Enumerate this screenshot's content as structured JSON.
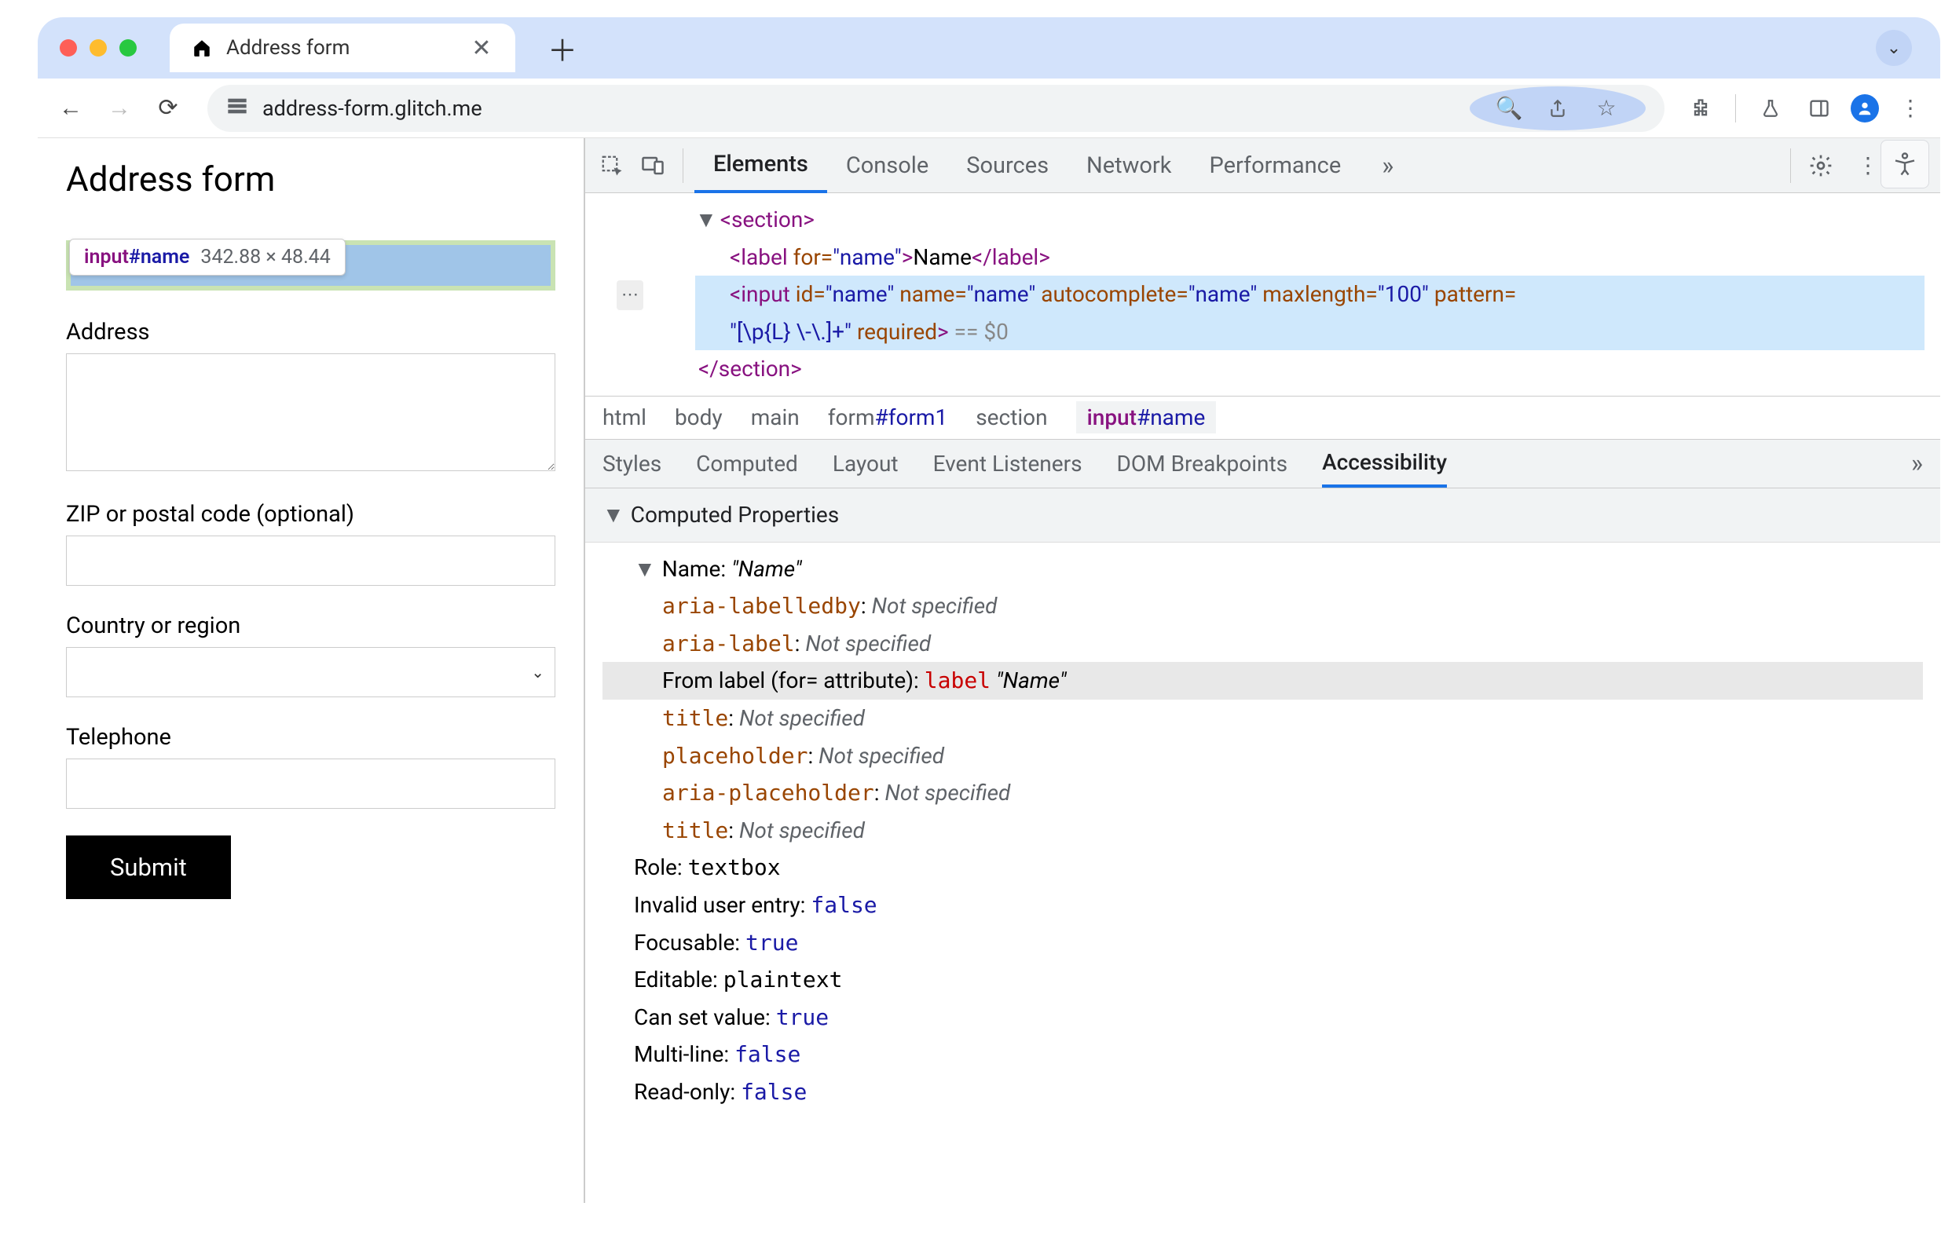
{
  "browser": {
    "tab_title": "Address form",
    "url": "address-form.glitch.me"
  },
  "page": {
    "title": "Address form",
    "tooltip": {
      "tag": "input",
      "id": "#name",
      "dims": "342.88 × 48.44"
    },
    "labels": {
      "address": "Address",
      "zip": "ZIP or postal code (optional)",
      "country": "Country or region",
      "telephone": "Telephone",
      "submit": "Submit"
    }
  },
  "devtools": {
    "tabs": [
      "Elements",
      "Console",
      "Sources",
      "Network",
      "Performance"
    ],
    "active_tab": "Elements",
    "more": "»",
    "dom": {
      "section_open": "<section>",
      "label_open": "<label ",
      "label_for_attr": "for=",
      "label_for_val": "\"name\"",
      "label_close": ">",
      "label_text": "Name",
      "label_end": "</label>",
      "input_open": "<input ",
      "id_attr": "id=",
      "id_val": "\"name\"",
      "name_attr": "name=",
      "name_val": "\"name\"",
      "ac_attr": "autocomplete=",
      "ac_val": "\"name\"",
      "maxlen_attr": "maxlength=",
      "maxlen_val": "\"100\"",
      "pattern_attr": "pattern=",
      "pattern_val": "\"[\\p{L} \\-\\.]+\"",
      "req_attr": "required",
      "input_close": ">",
      "eq_zero": "== $0",
      "section_close": "</section>"
    },
    "breadcrumb": [
      "html",
      "body",
      "main",
      "form#form1",
      "section",
      "input#name"
    ],
    "subtabs": [
      "Styles",
      "Computed",
      "Layout",
      "Event Listeners",
      "DOM Breakpoints",
      "Accessibility"
    ],
    "active_subtab": "Accessibility",
    "accessibility": {
      "header": "Computed Properties",
      "name_label": "Name: ",
      "name_value": "\"Name\"",
      "props": [
        {
          "k": "aria-labelledby",
          "v": "Not specified",
          "mono": true
        },
        {
          "k": "aria-label",
          "v": "Not specified",
          "mono": true
        }
      ],
      "from_label_prefix": "From label (for= attribute): ",
      "from_label_token": "label",
      "from_label_value": "\"Name\"",
      "props2": [
        {
          "k": "title",
          "v": "Not specified",
          "mono": true
        },
        {
          "k": "placeholder",
          "v": "Not specified",
          "mono": true
        },
        {
          "k": "aria-placeholder",
          "v": "Not specified",
          "mono": true
        },
        {
          "k": "title",
          "v": "Not specified",
          "mono": true
        }
      ],
      "below": [
        {
          "k": "Role: ",
          "v": "textbox",
          "vmono": true
        },
        {
          "k": "Invalid user entry: ",
          "v": "false",
          "blue": true
        },
        {
          "k": "Focusable: ",
          "v": "true",
          "blue": true
        },
        {
          "k": "Editable: ",
          "v": "plaintext",
          "vmono": true
        },
        {
          "k": "Can set value: ",
          "v": "true",
          "blue": true
        },
        {
          "k": "Multi-line: ",
          "v": "false",
          "blue": true
        },
        {
          "k": "Read-only: ",
          "v": "false",
          "blue": true
        }
      ]
    }
  }
}
